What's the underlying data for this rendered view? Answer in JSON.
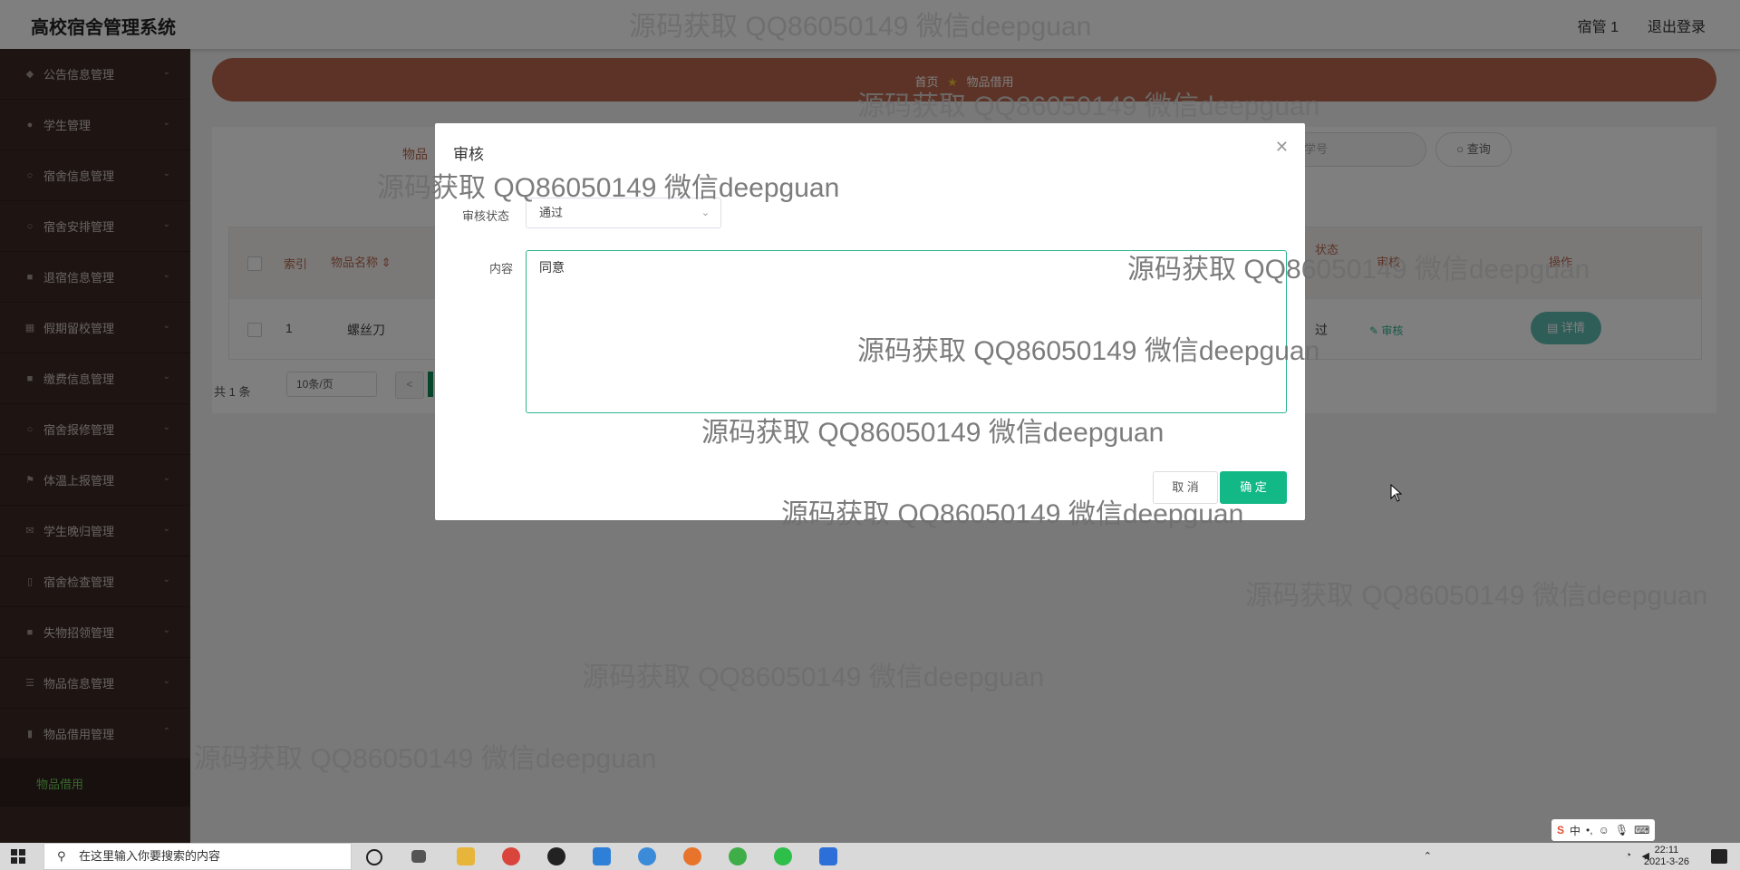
{
  "header": {
    "brand": "高校宿舍管理系统",
    "user": "宿管 1",
    "logout": "退出登录"
  },
  "sidebar": {
    "items": [
      {
        "label": "公告信息管理",
        "icon": "megaphone-icon"
      },
      {
        "label": "学生管理",
        "icon": "user-icon"
      },
      {
        "label": "宿舍信息管理",
        "icon": "home-icon"
      },
      {
        "label": "宿舍安排管理",
        "icon": "calendar-icon"
      },
      {
        "label": "退宿信息管理",
        "icon": "list-icon"
      },
      {
        "label": "假期留校管理",
        "icon": "grid-icon"
      },
      {
        "label": "缴费信息管理",
        "icon": "money-icon"
      },
      {
        "label": "宿舍报修管理",
        "icon": "wrench-icon"
      },
      {
        "label": "体温上报管理",
        "icon": "flag-icon"
      },
      {
        "label": "学生晚归管理",
        "icon": "mail-icon"
      },
      {
        "label": "宿舍检查管理",
        "icon": "check-icon"
      },
      {
        "label": "失物招领管理",
        "icon": "box-icon"
      },
      {
        "label": "物品信息管理",
        "icon": "menu-icon"
      },
      {
        "label": "物品借用管理",
        "icon": "doc-icon"
      }
    ],
    "active_sub": "物品借用"
  },
  "breadcrumb": {
    "home": "首页",
    "current": "物品借用"
  },
  "search": {
    "label": "物品",
    "placeholder": "学号",
    "button": "查询"
  },
  "table": {
    "headers": {
      "index": "索引",
      "name": "物品名称",
      "status": "状态",
      "audit": "审核",
      "action": "操作"
    },
    "rows": [
      {
        "index": "1",
        "name": "螺丝刀",
        "status": "过",
        "audit": "审核",
        "detail": "详情"
      }
    ]
  },
  "pager": {
    "total": "共 1 条",
    "page_size": "10条/页",
    "prev": "<"
  },
  "dialog": {
    "title": "审核",
    "status_label": "审核状态",
    "status_value": "通过",
    "content_label": "内容",
    "content_value": "同意",
    "cancel": "取 消",
    "ok": "确 定"
  },
  "watermark_text": "源码获取 QQ86050149 微信deepguan",
  "taskbar": {
    "search_placeholder": "在这里输入你要搜索的内容",
    "time": "22:11",
    "date": "2021-3-26",
    "ime": "中"
  },
  "colors": {
    "sidebar": "#3d2a25",
    "accent": "#b8674c",
    "primary": "#12b886"
  }
}
